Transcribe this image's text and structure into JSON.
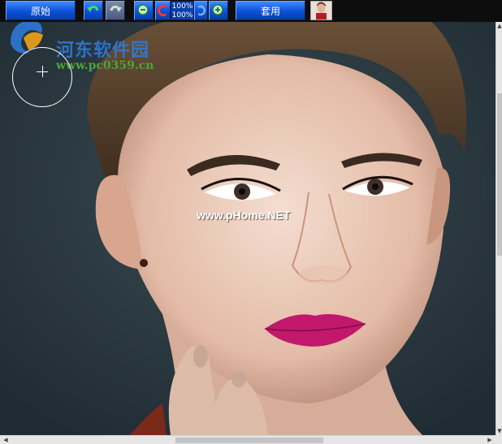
{
  "toolbar": {
    "original_label": "原始",
    "apply_label": "套用",
    "zoom_top": "100%",
    "zoom_bottom": "100%",
    "icons": [
      "undo-icon",
      "redo-icon",
      "zoom-out-icon",
      "rotate-left-icon",
      "rotate-right-icon",
      "zoom-in-icon"
    ]
  },
  "canvas": {
    "watermark_site": "河东软件园",
    "watermark_url": "www.pc0359.cn",
    "watermark_phome": "www.pHome.NET"
  },
  "colors": {
    "toolbar_button": "#0b50d6",
    "background": "#2c3b44",
    "lip": "#c2186b"
  }
}
